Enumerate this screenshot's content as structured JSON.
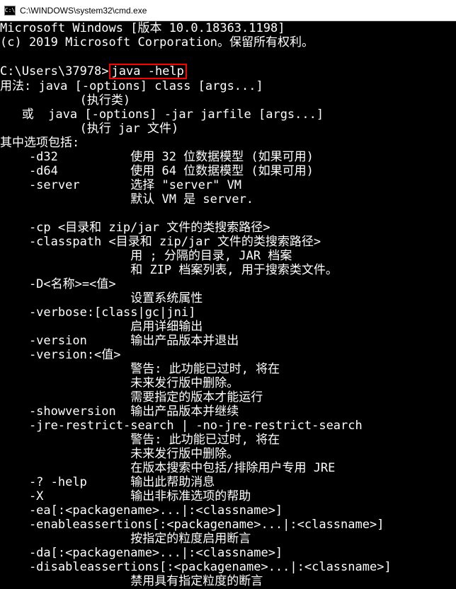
{
  "titlebar": {
    "title": "C:\\WINDOWS\\system32\\cmd.exe"
  },
  "terminal": {
    "line1": "Microsoft Windows [版本 10.0.18363.1198]",
    "line2": "(c) 2019 Microsoft Corporation。保留所有权利。",
    "blank1": "",
    "prompt_prefix": "C:\\Users\\37978>",
    "prompt_cmd": "java -help",
    "usage1": "用法: java [-options] class [args...]",
    "usage2": "           (执行类)",
    "usage3": "   或  java [-options] -jar jarfile [args...]",
    "usage4": "           (执行 jar 文件)",
    "opts_header": "其中选项包括:",
    "d32": "    -d32          使用 32 位数据模型 (如果可用)",
    "d64": "    -d64          使用 64 位数据模型 (如果可用)",
    "server1": "    -server       选择 \"server\" VM",
    "server2": "                  默认 VM 是 server.",
    "blank2": "",
    "cp": "    -cp <目录和 zip/jar 文件的类搜索路径>",
    "classpath1": "    -classpath <目录和 zip/jar 文件的类搜索路径>",
    "classpath2": "                  用 ; 分隔的目录, JAR 档案",
    "classpath3": "                  和 ZIP 档案列表, 用于搜索类文件。",
    "dname": "    -D<名称>=<值>",
    "dname2": "                  设置系统属性",
    "verbose1": "    -verbose:[class|gc|jni]",
    "verbose2": "                  启用详细输出",
    "version1": "    -version      输出产品版本并退出",
    "version2": "    -version:<值>",
    "version3": "                  警告: 此功能已过时, 将在",
    "version4": "                  未来发行版中删除。",
    "version5": "                  需要指定的版本才能运行",
    "showver": "    -showversion  输出产品版本并继续",
    "jre1": "    -jre-restrict-search | -no-jre-restrict-search",
    "jre2": "                  警告: 此功能已过时, 将在",
    "jre3": "                  未来发行版中删除。",
    "jre4": "                  在版本搜索中包括/排除用户专用 JRE",
    "help": "    -? -help      输出此帮助消息",
    "x": "    -X            输出非标准选项的帮助",
    "ea1": "    -ea[:<packagename>...|:<classname>]",
    "ea2": "    -enableassertions[:<packagename>...|:<classname>]",
    "ea3": "                  按指定的粒度启用断言",
    "da1": "    -da[:<packagename>...|:<classname>]",
    "da2": "    -disableassertions[:<packagename>...|:<classname>]",
    "da3": "                  禁用具有指定粒度的断言"
  }
}
